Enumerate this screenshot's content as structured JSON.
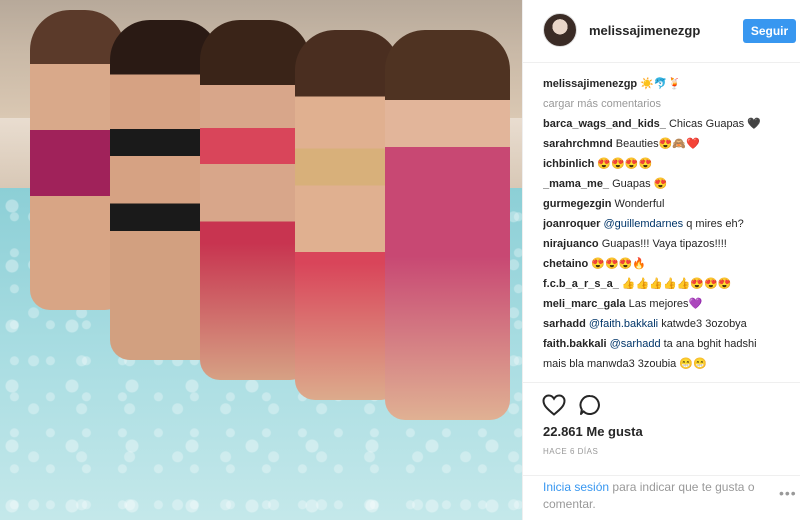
{
  "post": {
    "username": "melissajimenezgp",
    "follow_label": "Seguir",
    "caption_user": "melissajimenezgp",
    "caption_text": "☀️🐬🍹",
    "load_more": "cargar más comentarios",
    "comments": [
      {
        "user": "barca_wags_and_kids_",
        "text": "Chicas Guapas 🖤"
      },
      {
        "user": "sarahrchmnd",
        "text": "Beauties😍🙈❤️"
      },
      {
        "user": "ichbinlich",
        "text": "😍😍😍😍"
      },
      {
        "user": "_mama_me_",
        "text": "Guapas 😍"
      },
      {
        "user": "gurmegezgin",
        "text": "Wonderful"
      },
      {
        "user": "joanroquer",
        "mention": "@guillemdarnes",
        "text": "q mires eh?"
      },
      {
        "user": "nirajuanco",
        "text": "Guapas!!! Vaya tipazos!!!!"
      },
      {
        "user": "chetaino",
        "text": "😍😍😍🔥"
      },
      {
        "user": "f.c.b_a_r_s_a_",
        "text": "👍👍👍👍👍😍😍😍"
      },
      {
        "user": "meli_marc_gala",
        "text": "Las mejores💜"
      },
      {
        "user": "sarhadd",
        "mention": "@faith.bakkali",
        "text": "katwde3 3ozobya"
      },
      {
        "user": "faith.bakkali",
        "mention": "@sarhadd",
        "text": "ta ana bghit hadshi",
        "text2": "mais bla manwda3 3zoubia 😁😁"
      }
    ],
    "likes": "22.861 Me gusta",
    "time": "HACE 6 DÍAS",
    "login_link": "Inicia sesión",
    "login_text": "para indicar que te gusta o",
    "login_text2": "comentar.",
    "more_options": "•••"
  },
  "icons": {
    "like": "heart-icon",
    "comment": "comment-bubble-icon"
  },
  "colors": {
    "accent": "#3897f0",
    "muted": "#999999",
    "mention": "#003569"
  }
}
